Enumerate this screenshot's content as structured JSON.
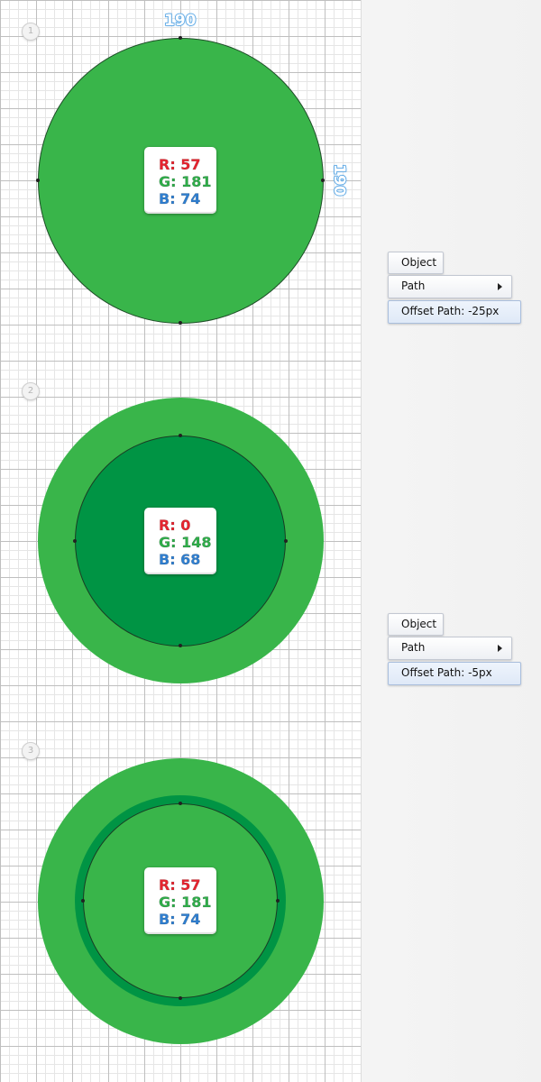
{
  "steps": [
    {
      "number": "1",
      "rgb": {
        "r": "R: 57",
        "g": "G: 181",
        "b": "B: 74"
      },
      "dimensions": {
        "width": "190",
        "height": "190"
      },
      "menu": {
        "object": "Object",
        "path": "Path",
        "command": "Offset Path: -25px"
      }
    },
    {
      "number": "2",
      "rgb": {
        "r": "R: 0",
        "g": "G: 148",
        "b": "B: 68"
      },
      "menu": {
        "object": "Object",
        "path": "Path",
        "command": "Offset Path: -5px"
      }
    },
    {
      "number": "3",
      "rgb": {
        "r": "R: 57",
        "g": "G: 181",
        "b": "B: 74"
      }
    }
  ],
  "colors": {
    "light_green": "#39b54a",
    "dark_green": "#009444",
    "red_label": "#e8242f",
    "green_label": "#2fae4a",
    "blue_label": "#2f7fd1",
    "dimension_blue": "#4a9fe3"
  }
}
